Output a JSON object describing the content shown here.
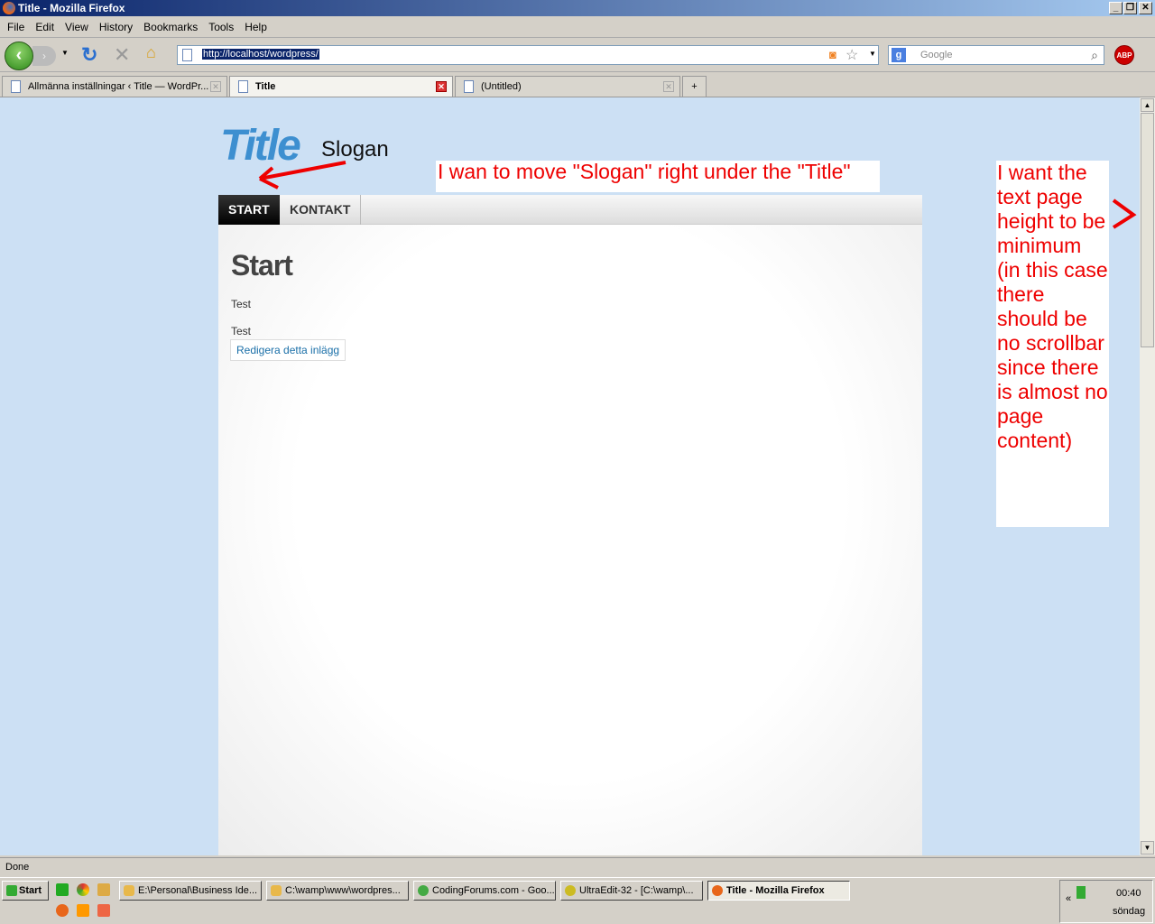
{
  "window": {
    "title": "Title - Mozilla Firefox"
  },
  "menu": [
    "File",
    "Edit",
    "View",
    "History",
    "Bookmarks",
    "Tools",
    "Help"
  ],
  "address": {
    "url": "http://localhost/wordpress/"
  },
  "search": {
    "placeholder": "Google"
  },
  "abp": "ABP",
  "tabs": [
    {
      "label": "Allmänna inställningar ‹ Title — WordPr..."
    },
    {
      "label": "Title"
    },
    {
      "label": "(Untitled)"
    }
  ],
  "page": {
    "logo": "Title",
    "slogan": "Slogan",
    "nav": [
      "START",
      "KONTAKT"
    ],
    "heading": "Start",
    "paragraphs": [
      "Test",
      "Test"
    ],
    "edit_link": "Redigera detta inlägg"
  },
  "annotations": {
    "note1": "I wan to move \"Slogan\" right under the \"Title\"",
    "note2": "I want the text page height to be minimum (in this case there should be no scrollbar since there is almost no page content)"
  },
  "status": "Done",
  "taskbar": {
    "start": "Start",
    "items": [
      "E:\\Personal\\Business Ide...",
      "C:\\wamp\\www\\wordpres...",
      "CodingForums.com - Goo...",
      "UltraEdit-32 - [C:\\wamp\\...",
      "Title - Mozilla Firefox"
    ],
    "time": "00:40",
    "day": "söndag"
  }
}
